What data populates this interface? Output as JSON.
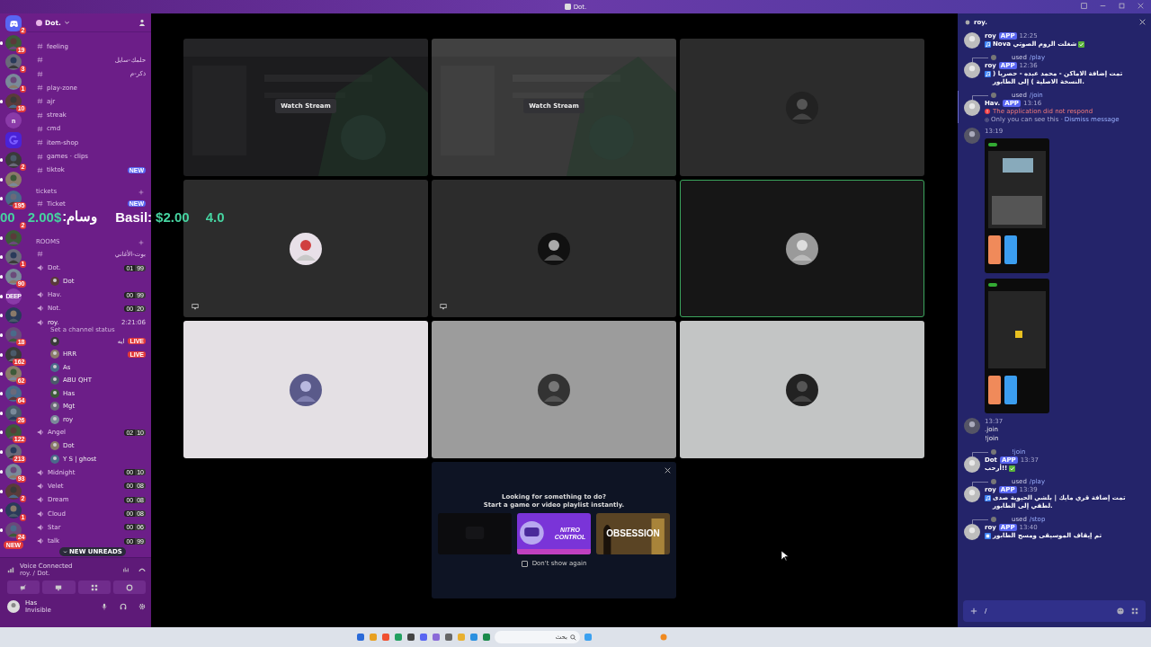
{
  "titlebar": {
    "title": "Dot."
  },
  "servers": [
    {
      "kind": "home",
      "badge": "2",
      "unread": false
    },
    {
      "kind": "picture",
      "badge": "19",
      "unread": true
    },
    {
      "kind": "picture",
      "badge": "3",
      "unread": false
    },
    {
      "kind": "picture",
      "badge": "1",
      "unread": false
    },
    {
      "kind": "picture",
      "badge": "10",
      "unread": true
    },
    {
      "kind": "letter",
      "label": "n",
      "unread": false
    },
    {
      "kind": "logo",
      "unread": false
    },
    {
      "kind": "picture",
      "badge": "2",
      "unread": true
    },
    {
      "kind": "picture",
      "unread": true
    },
    {
      "kind": "picture",
      "badge": "195",
      "unread": true
    },
    {
      "kind": "covered",
      "badge": "2",
      "unread": false
    },
    {
      "kind": "picture",
      "unread": true
    },
    {
      "kind": "picture",
      "badge": "1",
      "unread": true
    },
    {
      "kind": "picture",
      "badge": "90",
      "unread": true
    },
    {
      "kind": "letter",
      "label": "DEEP",
      "unread": true
    },
    {
      "kind": "picture",
      "unread": true
    },
    {
      "kind": "picture",
      "badge": "18",
      "unread": true
    },
    {
      "kind": "picture",
      "badge": "162",
      "unread": true
    },
    {
      "kind": "picture",
      "badge": "62",
      "unread": true
    },
    {
      "kind": "picture",
      "badge": "64",
      "unread": true
    },
    {
      "kind": "picture",
      "badge": "26",
      "unread": true
    },
    {
      "kind": "picture",
      "badge": "122",
      "unread": true
    },
    {
      "kind": "picture",
      "badge": "213",
      "unread": true
    },
    {
      "kind": "picture",
      "badge": "93",
      "unread": true
    },
    {
      "kind": "picture",
      "badge": "2",
      "unread": true
    },
    {
      "kind": "picture",
      "badge": "1",
      "unread": true
    },
    {
      "kind": "picture",
      "badge": "24",
      "unread": true
    }
  ],
  "new_pill": "NEW",
  "server_name": "Dot.",
  "channels": [
    {
      "kind": "text",
      "name": "feeling"
    },
    {
      "kind": "text",
      "name": "حلمك-سايل"
    },
    {
      "kind": "text",
      "name": "ذكر-م"
    },
    {
      "kind": "text",
      "name": "play-zone"
    },
    {
      "kind": "text",
      "name": "ajr"
    },
    {
      "kind": "text",
      "name": "streak"
    },
    {
      "kind": "text",
      "name": "cmd"
    },
    {
      "kind": "text",
      "name": "item-shop"
    },
    {
      "kind": "text",
      "name": "games · clips"
    },
    {
      "kind": "text",
      "name": "tiktok",
      "badge": "NEW"
    },
    {
      "kind": "category",
      "name": "tickets"
    },
    {
      "kind": "text",
      "name": "Ticket",
      "badge": "NEW"
    },
    {
      "kind": "category",
      "name": "ROOMS"
    },
    {
      "kind": "text",
      "name": "بوت-الأغاني"
    },
    {
      "kind": "voice",
      "name": "Dot.",
      "users": "01",
      "limit": "99",
      "children": [
        {
          "name": "Dot"
        }
      ]
    },
    {
      "kind": "voice",
      "name": "Hav.",
      "users": "00",
      "limit": "99"
    },
    {
      "kind": "voice",
      "name": "Not.",
      "users": "00",
      "limit": "20"
    },
    {
      "kind": "voice",
      "name": "roy.",
      "timer": "2:21:06",
      "status": "Set a channel status",
      "children": [
        {
          "name": "ايه",
          "tag": "LIVE"
        },
        {
          "name": "HRR",
          "tag": "LIVE"
        },
        {
          "name": "As"
        },
        {
          "name": "ABU QHT"
        },
        {
          "name": "Has"
        },
        {
          "name": "Mgt"
        },
        {
          "name": "roy"
        }
      ]
    },
    {
      "kind": "voice",
      "name": "Angel",
      "users": "02",
      "limit": "10",
      "children": [
        {
          "name": "Dot"
        },
        {
          "name": "Y S | ghost"
        }
      ]
    },
    {
      "kind": "voice",
      "name": "Midnight",
      "users": "00",
      "limit": "10"
    },
    {
      "kind": "voice",
      "name": "Velet",
      "users": "00",
      "limit": "08"
    },
    {
      "kind": "voice",
      "name": "Dream",
      "users": "00",
      "limit": "08"
    },
    {
      "kind": "voice",
      "name": "Cloud",
      "users": "00",
      "limit": "08"
    },
    {
      "kind": "voice",
      "name": "Star",
      "users": "00",
      "limit": "06"
    },
    {
      "kind": "voice",
      "name": "talk",
      "users": "00",
      "limit": "99"
    }
  ],
  "new_unreads": "NEW UNREADS",
  "voice_panel": {
    "title": "Voice Connected",
    "location": "roy. / Dot."
  },
  "user": {
    "name": "Has",
    "status": "Invisible"
  },
  "overlay": [
    {
      "kind": "amount",
      "text": "00"
    },
    {
      "kind": "amount",
      "text": "2.00$"
    },
    {
      "kind": "label",
      "text": "وسام:"
    },
    {
      "kind": "label",
      "text": "Basil:"
    },
    {
      "kind": "amount",
      "text": "$2.00"
    },
    {
      "kind": "amount",
      "text": "4.0"
    }
  ],
  "tiles": [
    {
      "kind": "stream",
      "color": "#1c1c1e",
      "action": "Watch Stream",
      "speaking": false
    },
    {
      "kind": "stream",
      "color": "#3a3a3a",
      "action": "Watch Stream",
      "speaking": false
    },
    {
      "kind": "avatar",
      "color": "#2c2c2c",
      "speaking": false
    },
    {
      "kind": "sharing",
      "color": "#2c2c2c",
      "speaking": false
    },
    {
      "kind": "sharing",
      "color": "#2c2c2c",
      "speaking": false
    },
    {
      "kind": "avatar",
      "color": "#161616",
      "speaking": true
    },
    {
      "kind": "avatar",
      "color": "#e4e0e4",
      "speaking": false
    },
    {
      "kind": "avatar",
      "color": "#9c9c9c",
      "speaking": false
    },
    {
      "kind": "avatar",
      "color": "#c3c5c5",
      "speaking": false
    }
  ],
  "activity_popup": {
    "lines": [
      "Looking for something to do?",
      "Start a game or video playlist instantly."
    ],
    "games": [
      {
        "kind": "dark"
      },
      {
        "kind": "art",
        "title": "NITRO CONTROL"
      },
      {
        "kind": "cover",
        "title": "OBSESSION"
      }
    ],
    "dont_show": {
      "label": "Don't show again",
      "checked": false
    }
  },
  "chat": {
    "title": "roy.",
    "messages": [
      {
        "author": "roy",
        "tag": "APP",
        "time": "12:25",
        "music_icon": true,
        "text": "**Nova** شغلت الروم الصوتي",
        "check_icon": true
      },
      {
        "reply": {
          "verb": "used",
          "command": "/play"
        },
        "author": "roy",
        "tag": "APP",
        "time": "12:36",
        "music_icon": true,
        "text": "تمت إضافة الاماكن - محمد عبده - حصريا ( النسخة الاصلية ) إلى الطابور."
      },
      {
        "reply": {
          "verb": "used",
          "command": "/join"
        },
        "author": "Hav.",
        "tag": "APP",
        "time": "13:16",
        "error": "The application did not respond",
        "note": "Only you can see this ·",
        "link": "Dismiss message"
      },
      {
        "time": "13:19",
        "attachments": [
          {
            "kind": "picture"
          },
          {
            "kind": "picture"
          }
        ]
      },
      {
        "time": "13:37",
        "lines": [
          ".join",
          "!join"
        ]
      },
      {
        "reply": {
          "command": "!join"
        },
        "author": "Dot",
        "tag": "APP",
        "time": "13:37",
        "text": "أرحب!!",
        "check_icon": true
      },
      {
        "reply": {
          "verb": "used",
          "command": "/play"
        },
        "author": "roy",
        "tag": "APP",
        "time": "13:39",
        "music_icon": true,
        "text": "تمت إضافة قري مايك | بلشي الحيوية صدى لطفي إلى الطابور."
      },
      {
        "reply": {
          "verb": "used",
          "command": "/stop"
        },
        "author": "roy",
        "tag": "APP",
        "time": "13:40",
        "stop_icon": true,
        "text": "تم إيقاف الموسيقى ومسح الطابور"
      }
    ],
    "input": {
      "value": "/"
    }
  },
  "taskbar": {
    "placeholder": "بحث"
  }
}
